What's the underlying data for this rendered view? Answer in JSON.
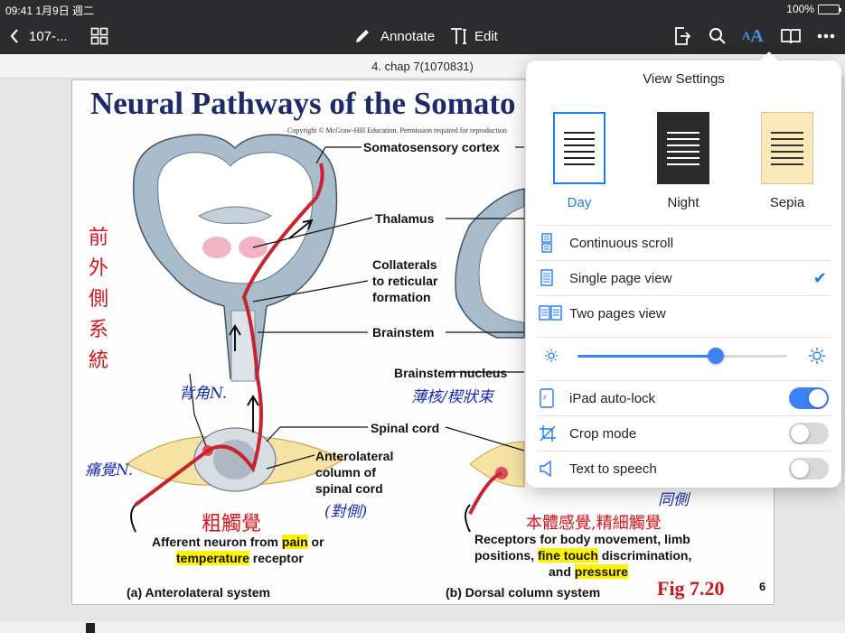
{
  "status_bar": {
    "time_date": "09:41  1月9日 週二",
    "battery": "100%"
  },
  "toolbar": {
    "back_label": "107-...",
    "annotate_label": "Annotate",
    "edit_label": "Edit",
    "text_size_icon_label": "AA"
  },
  "document": {
    "page_title": "4. chap 7(1070831)",
    "figure": {
      "title": "Neural Pathways of the Somato",
      "copyright": "Copyright © McGraw-Hill Education. Permission required for reproduction",
      "labels": {
        "somatosensory_cortex": "Somatosensory cortex",
        "thalamus": "Thalamus",
        "collaterals": "Collaterals to reticular formation",
        "brainstem": "Brainstem",
        "brainstem_nucleus": "Brainstem nucleus",
        "spinal_cord": "Spinal cord",
        "anterolateral_column": "Anterolateral column of spinal cord"
      },
      "left_receptor": {
        "line1_a": "Afferent neuron from ",
        "line1_hl": "pain",
        "line1_b": " or",
        "line2_hl": "temperature",
        "line2_b": " receptor"
      },
      "right_receptor": {
        "line1": "Receptors for body movement, limb",
        "line2_a": "positions, ",
        "line2_hl": "fine touch",
        "line2_b": " discrimination,",
        "line3_a": "and ",
        "line3_hl": "pressure"
      },
      "caption_a": "(a) Anterolateral system",
      "caption_b": "(b) Dorsal column system",
      "fig_number": "Fig 7.20",
      "page_number": "6"
    },
    "handwriting": {
      "red_vertical": "前外側系統",
      "blue_dorsal_horn": "背角N.",
      "blue_pain_sense": "痛覺N.",
      "blue_contralateral": "(對側)",
      "red_coarse_touch": "粗觸覺",
      "blue_nucleus": "薄核/楔狀束",
      "red_proprio": "本體感覺,精細觸覺",
      "blue_same_side": "同側"
    }
  },
  "view_settings": {
    "title": "View Settings",
    "themes": [
      {
        "label": "Day",
        "selected": true,
        "bg": "#ffffff",
        "line": "#222222"
      },
      {
        "label": "Night",
        "selected": false,
        "bg": "#2b2b2b",
        "line": "#ffffff"
      },
      {
        "label": "Sepia",
        "selected": false,
        "bg": "#fbe9b9",
        "line": "#333333"
      }
    ],
    "layout_options": [
      {
        "label": "Continuous scroll",
        "icon": "continuous-scroll-icon",
        "checked": false
      },
      {
        "label": "Single page view",
        "icon": "single-page-icon",
        "checked": true
      },
      {
        "label": "Two pages view",
        "icon": "two-pages-icon",
        "checked": false
      }
    ],
    "brightness": 0.66,
    "toggles": [
      {
        "label": "iPad auto-lock",
        "icon": "auto-lock-icon",
        "on": true
      },
      {
        "label": "Crop mode",
        "icon": "crop-icon",
        "on": false
      },
      {
        "label": "Text to speech",
        "icon": "speaker-icon",
        "on": false
      }
    ],
    "accent": "#1e7bf2"
  }
}
